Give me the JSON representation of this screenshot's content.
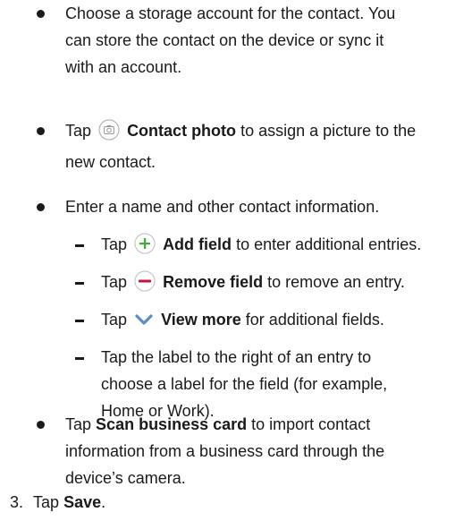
{
  "items": {
    "b1": {
      "lines": [
        "Choose a storage account for the contact. You",
        "can store the contact on the device or sync it",
        "with an account."
      ]
    },
    "b2": {
      "pre": "Tap",
      "icon": "camera-icon",
      "bold": "Contact photo",
      "post": "to assign a picture to the",
      "line2": "new contact."
    },
    "b3": {
      "text": "Enter a name and other contact information."
    },
    "s1": {
      "pre": "Tap",
      "icon": "add-icon",
      "icon_color": "#3daa3d",
      "bold": "Add field",
      "post": "to enter additional entries."
    },
    "s2": {
      "pre": "Tap",
      "icon": "remove-icon",
      "icon_color": "#c0143c",
      "bold": "Remove field",
      "post": "to remove an entry."
    },
    "s3": {
      "pre": "Tap",
      "icon": "chevron-down-icon",
      "icon_color": "#5a8ec8",
      "bold": "View more",
      "post": "for additional fields."
    },
    "s4": {
      "lines": [
        "Tap the label to the right of an entry to",
        "choose a label for the field (for example,",
        "Home or Work)."
      ]
    },
    "b4": {
      "pre": "Tap",
      "bold": "Scan business card",
      "post": "to import contact",
      "line2": "information from a business card through the",
      "line3": "device’s camera."
    }
  },
  "step3": {
    "number": "3.",
    "pre": "Tap",
    "bold": "Save",
    "post": "."
  }
}
